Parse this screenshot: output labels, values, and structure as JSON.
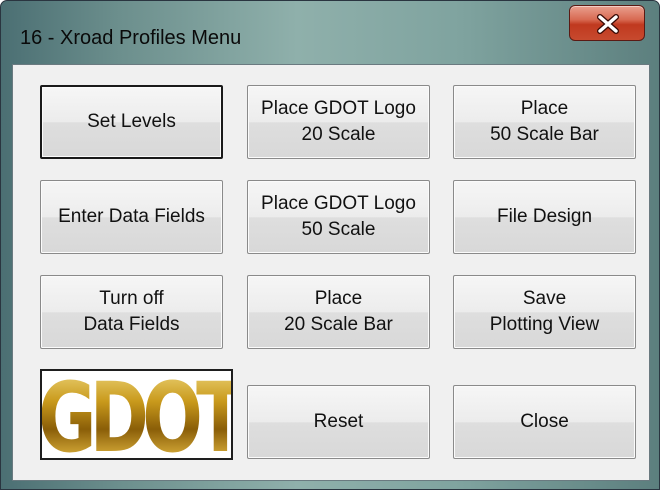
{
  "window": {
    "title": "16 - Xroad Profiles Menu",
    "close_icon": "close-x-icon"
  },
  "buttons": {
    "set_levels": "Set Levels",
    "place_gdot_logo_20": "Place GDOT Logo\n20 Scale",
    "place_50_scale_bar": "Place\n50 Scale Bar",
    "enter_data_fields": "Enter Data Fields",
    "place_gdot_logo_50": "Place GDOT Logo\n50 Scale",
    "file_design": "File Design",
    "turn_off_data_fields": "Turn off\nData Fields",
    "place_20_scale_bar": "Place\n20 Scale Bar",
    "save_plotting_view": "Save\nPlotting View",
    "reset": "Reset",
    "close": "Close"
  },
  "logo": {
    "text": "GDOT",
    "color": "#b8860b"
  },
  "colors": {
    "close_button": "#c74a2e",
    "dialog_background": "#f0f0f0"
  }
}
